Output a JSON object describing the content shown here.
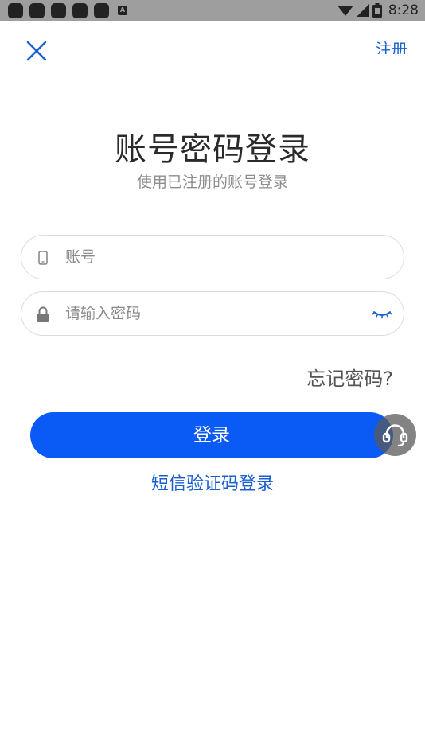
{
  "status_bar": {
    "time": "8:28",
    "notification_icons": [
      "app-icon",
      "app-icon",
      "app-icon",
      "app-icon",
      "app-icon"
    ],
    "badge_letter": "A"
  },
  "header": {
    "close_icon": "close-icon",
    "register_label": "注册"
  },
  "title": "账号密码登录",
  "subtitle": "使用已注册的账号登录",
  "account_field": {
    "icon": "phone-icon",
    "placeholder": "账号"
  },
  "password_field": {
    "icon": "lock-icon",
    "placeholder": "请输入密码",
    "toggle_icon": "eye-closed-icon"
  },
  "forgot_label": "忘记密码?",
  "login_label": "登录",
  "sms_login_label": "短信验证码登录",
  "colors": {
    "primary": "#0a5af5",
    "link": "#1a5fd0",
    "status_bar": "#9e9e9e"
  }
}
